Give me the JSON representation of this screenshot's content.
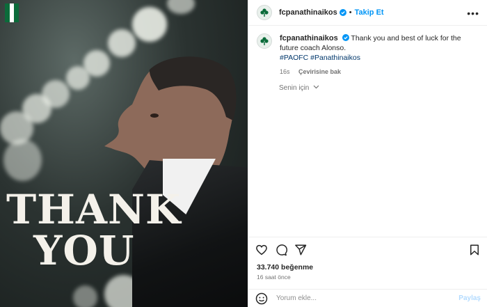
{
  "post": {
    "image": {
      "overlay_line1": "THANK",
      "overlay_line2": "YOU",
      "flag_colors": [
        "#0b6b3a",
        "#ffffff",
        "#0b6b3a"
      ]
    },
    "header": {
      "username": "fcpanathinaikos",
      "separator": "•",
      "follow_label": "Takip Et",
      "more_icon": "more-horizontal-icon"
    },
    "caption": {
      "username": "fcpanathinaikos",
      "text": "Thank you and best of luck for the future coach Alonso.",
      "hashtags": "#PAOFC #Panathinaikos",
      "time": "16s",
      "translate_label": "Çevirisine bak"
    },
    "for_you_label": "Senin için",
    "actions": {
      "like_icon": "heart-icon",
      "comment_icon": "comment-icon",
      "share_icon": "send-icon",
      "save_icon": "bookmark-icon"
    },
    "likes": "33.740 beğenme",
    "posted_ago": "16 saat önce",
    "comment_box": {
      "placeholder": "Yorum ekle...",
      "share_label": "Paylaş"
    },
    "colors": {
      "accent": "#0095f6",
      "hashtag": "#00376b",
      "muted": "#737373",
      "verified": "#0095f6"
    }
  }
}
